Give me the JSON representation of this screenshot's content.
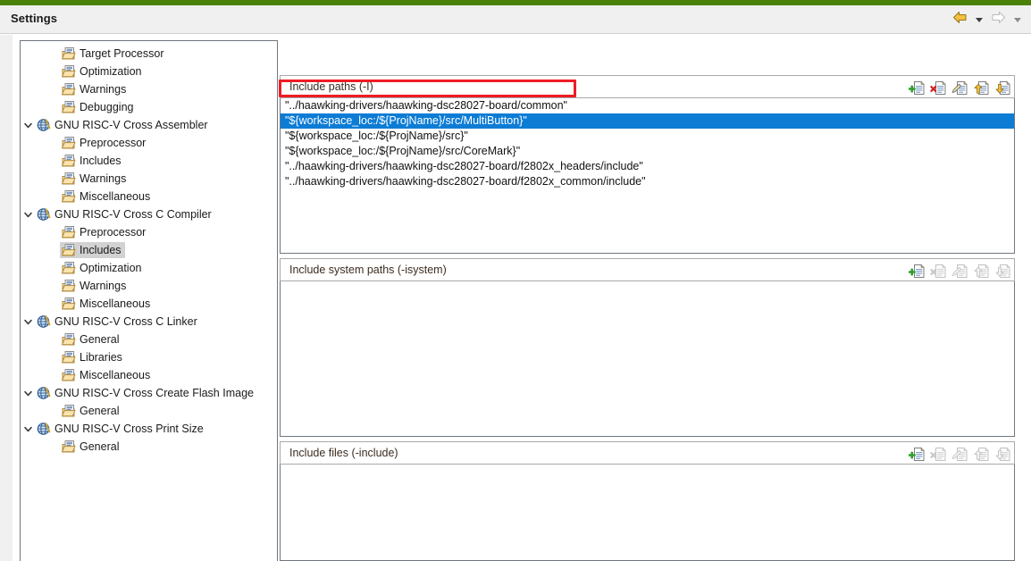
{
  "window": {
    "title": "Settings",
    "accent_green": "#4a8209",
    "nav": {
      "back_icon": "back-arrow-icon",
      "back_caret_icon": "chevron-down-icon",
      "forward_icon": "forward-arrow-icon",
      "forward_caret_icon": "chevron-down-icon"
    }
  },
  "tree": {
    "selected_label": "Includes",
    "items": [
      {
        "label": "Target Processor",
        "level": 1,
        "type": "leaf",
        "icon": "folder-page-icon",
        "expanded": null,
        "selected": false
      },
      {
        "label": "Optimization",
        "level": 1,
        "type": "leaf",
        "icon": "folder-page-icon",
        "expanded": null,
        "selected": false
      },
      {
        "label": "Warnings",
        "level": 1,
        "type": "leaf",
        "icon": "folder-page-icon",
        "expanded": null,
        "selected": false
      },
      {
        "label": "Debugging",
        "level": 1,
        "type": "leaf",
        "icon": "folder-page-icon",
        "expanded": null,
        "selected": false
      },
      {
        "label": "GNU RISC-V Cross Assembler",
        "level": 0,
        "type": "node",
        "icon": "tool-globe-icon",
        "expanded": true,
        "selected": false
      },
      {
        "label": "Preprocessor",
        "level": 1,
        "type": "leaf",
        "icon": "folder-page-icon",
        "expanded": null,
        "selected": false
      },
      {
        "label": "Includes",
        "level": 1,
        "type": "leaf",
        "icon": "folder-page-icon",
        "expanded": null,
        "selected": false
      },
      {
        "label": "Warnings",
        "level": 1,
        "type": "leaf",
        "icon": "folder-page-icon",
        "expanded": null,
        "selected": false
      },
      {
        "label": "Miscellaneous",
        "level": 1,
        "type": "leaf",
        "icon": "folder-page-icon",
        "expanded": null,
        "selected": false
      },
      {
        "label": "GNU RISC-V Cross C Compiler",
        "level": 0,
        "type": "node",
        "icon": "tool-globe-icon",
        "expanded": true,
        "selected": false
      },
      {
        "label": "Preprocessor",
        "level": 1,
        "type": "leaf",
        "icon": "folder-page-icon",
        "expanded": null,
        "selected": false
      },
      {
        "label": "Includes",
        "level": 1,
        "type": "leaf",
        "icon": "folder-page-icon",
        "expanded": null,
        "selected": true
      },
      {
        "label": "Optimization",
        "level": 1,
        "type": "leaf",
        "icon": "folder-page-icon",
        "expanded": null,
        "selected": false
      },
      {
        "label": "Warnings",
        "level": 1,
        "type": "leaf",
        "icon": "folder-page-icon",
        "expanded": null,
        "selected": false
      },
      {
        "label": "Miscellaneous",
        "level": 1,
        "type": "leaf",
        "icon": "folder-page-icon",
        "expanded": null,
        "selected": false
      },
      {
        "label": "GNU RISC-V Cross C Linker",
        "level": 0,
        "type": "node",
        "icon": "tool-globe-icon",
        "expanded": true,
        "selected": false
      },
      {
        "label": "General",
        "level": 1,
        "type": "leaf",
        "icon": "folder-page-icon",
        "expanded": null,
        "selected": false
      },
      {
        "label": "Libraries",
        "level": 1,
        "type": "leaf",
        "icon": "folder-page-icon",
        "expanded": null,
        "selected": false
      },
      {
        "label": "Miscellaneous",
        "level": 1,
        "type": "leaf",
        "icon": "folder-page-icon",
        "expanded": null,
        "selected": false
      },
      {
        "label": "GNU RISC-V Cross Create Flash Image",
        "level": 0,
        "type": "node",
        "icon": "tool-globe-icon",
        "expanded": true,
        "selected": false
      },
      {
        "label": "General",
        "level": 1,
        "type": "leaf",
        "icon": "folder-page-icon",
        "expanded": null,
        "selected": false
      },
      {
        "label": "GNU RISC-V Cross Print Size",
        "level": 0,
        "type": "node",
        "icon": "tool-globe-icon",
        "expanded": true,
        "selected": false
      },
      {
        "label": "General",
        "level": 1,
        "type": "leaf",
        "icon": "folder-page-icon",
        "expanded": null,
        "selected": false
      }
    ]
  },
  "toolbar_icons": [
    {
      "name": "add-icon",
      "title": "Add"
    },
    {
      "name": "delete-icon",
      "title": "Delete"
    },
    {
      "name": "edit-icon",
      "title": "Edit"
    },
    {
      "name": "move-up-icon",
      "title": "Move up"
    },
    {
      "name": "move-down-icon",
      "title": "Move down"
    }
  ],
  "panels": [
    {
      "title": "Include paths (-I)",
      "toolbar_enabled": [
        true,
        true,
        true,
        true,
        true
      ],
      "items": [
        "\"../haawking-drivers/haawking-dsc28027-board/common\"",
        "\"${workspace_loc:/${ProjName}/src/MultiButton}\"",
        "\"${workspace_loc:/${ProjName}/src}\"",
        "\"${workspace_loc:/${ProjName}/src/CoreMark}\"",
        "\"../haawking-drivers/haawking-dsc28027-board/f2802x_headers/include\"",
        "\"../haawking-drivers/haawking-dsc28027-board/f2802x_common/include\""
      ],
      "selected_index": 1
    },
    {
      "title": "Include system paths (-isystem)",
      "toolbar_enabled": [
        true,
        false,
        false,
        false,
        false
      ],
      "items": [],
      "selected_index": -1
    },
    {
      "title": "Include files (-include)",
      "toolbar_enabled": [
        true,
        false,
        false,
        false,
        false
      ],
      "items": [],
      "selected_index": -1
    }
  ],
  "annotation": {
    "color": "#ee1c25",
    "target_text": "\"${workspace_loc:/${ProjName}/src/MultiButton}\""
  },
  "colors": {
    "selection_blue": "#0c7cd5",
    "tree_selection_grey": "#d2d2d2",
    "panel_border": "#6f7780"
  }
}
